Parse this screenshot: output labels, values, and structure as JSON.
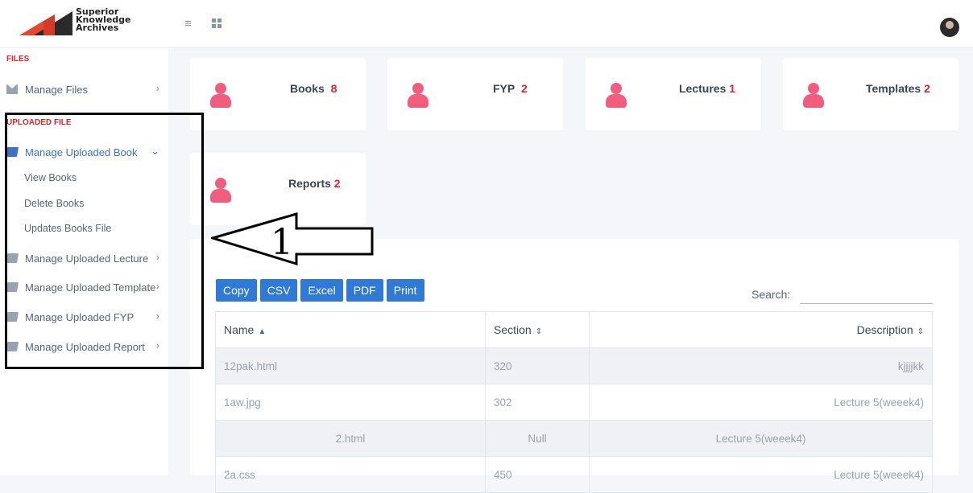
{
  "brand": {
    "line1": "Superior",
    "line2": "Knowledge",
    "line3": "Archives"
  },
  "topbar": {
    "menu_icon": "hamburger-icon",
    "apps_icon": "grid-icon"
  },
  "sidebar": {
    "files_heading": "FILES",
    "manage_files": "Manage Files",
    "uploaded_heading": "UPLOADED FILE",
    "manage_uploaded_book": "Manage Uploaded Book",
    "sub_items": [
      "View Books",
      "Delete Books",
      "Updates Books File"
    ],
    "manage_uploaded_lecture": "Manage Uploaded Lecture",
    "manage_uploaded_template": "Manage Uploaded Template",
    "manage_uploaded_fyp": "Manage Uploaded FYP",
    "manage_uploaded_report": "Manage Uploaded Report"
  },
  "cards": [
    {
      "label": "Books",
      "count": "8"
    },
    {
      "label": "FYP",
      "count": "2"
    },
    {
      "label": "Lectures",
      "count": "1"
    },
    {
      "label": "Templates",
      "count": "2"
    },
    {
      "label": "Reports",
      "count": "2"
    }
  ],
  "annotation": {
    "number": "1"
  },
  "toolbar": {
    "copy": "Copy",
    "csv": "CSV",
    "excel": "Excel",
    "pdf": "PDF",
    "print": "Print"
  },
  "search": {
    "label": "Search:",
    "value": ""
  },
  "table": {
    "headers": {
      "name": "Name",
      "section": "Section",
      "description": "Description"
    },
    "rows": [
      {
        "name": "12pak.html",
        "section": "320",
        "description": "kjjjjkk"
      },
      {
        "name": "1aw.jpg",
        "section": "302",
        "description": "Lecture 5(weeek4)"
      },
      {
        "name": "2.html",
        "section": "Null",
        "description": "Lecture 5(weeek4)"
      },
      {
        "name": "2a.css",
        "section": "450",
        "description": "Lecture 5(weeek4)"
      }
    ]
  },
  "colors": {
    "accent": "#2f7ad6",
    "alert": "#e0242b",
    "person": "#f25d7e",
    "active": "#3b71c9"
  }
}
